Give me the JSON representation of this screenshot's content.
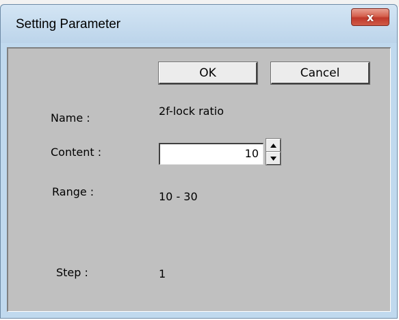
{
  "window": {
    "title": "Setting Parameter",
    "close_label": "x"
  },
  "buttons": {
    "ok_label": "OK",
    "cancel_label": "Cancel"
  },
  "fields": {
    "name_label": "Name :",
    "name_value": "2f-lock ratio",
    "content_label": "Content :",
    "content_value": "10",
    "range_label": "Range :",
    "range_value": "10 - 30",
    "step_label": "Step :",
    "step_value": "1"
  }
}
